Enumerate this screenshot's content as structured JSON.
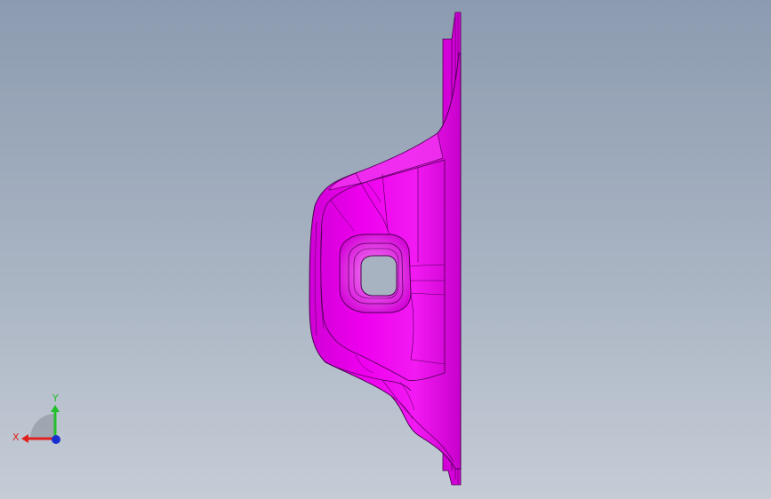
{
  "viewport": {
    "background_top": "#8c9bb0",
    "background_bottom": "#c5ccd6"
  },
  "part": {
    "color": "#e600e6",
    "edge_color": "#4a0050"
  },
  "triad": {
    "x_label": "X",
    "y_label": "Y",
    "x_color": "#e0201e",
    "y_color": "#22c02a",
    "z_color": "#1a2fd0"
  }
}
